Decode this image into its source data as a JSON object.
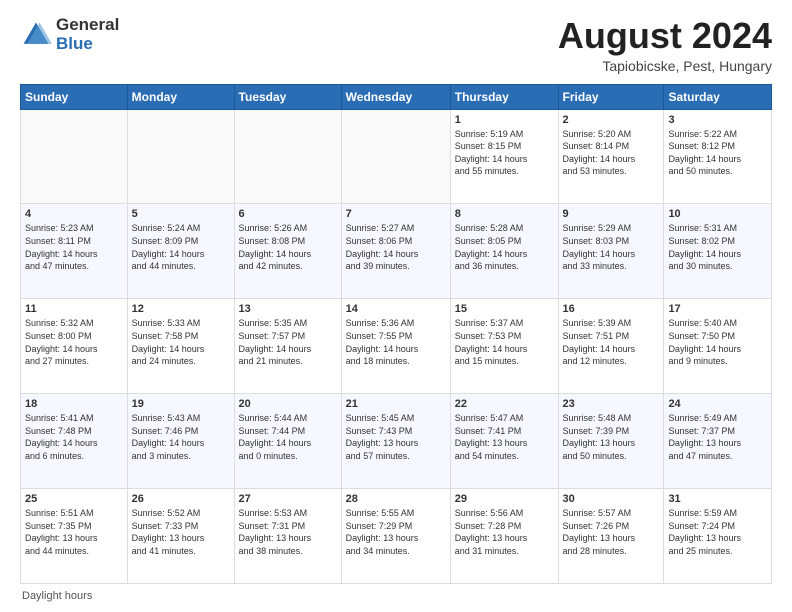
{
  "logo": {
    "general": "General",
    "blue": "Blue"
  },
  "title": "August 2024",
  "subtitle": "Tapiobicske, Pest, Hungary",
  "days_of_week": [
    "Sunday",
    "Monday",
    "Tuesday",
    "Wednesday",
    "Thursday",
    "Friday",
    "Saturday"
  ],
  "footer": "Daylight hours",
  "weeks": [
    [
      {
        "day": "",
        "info": ""
      },
      {
        "day": "",
        "info": ""
      },
      {
        "day": "",
        "info": ""
      },
      {
        "day": "",
        "info": ""
      },
      {
        "day": "1",
        "info": "Sunrise: 5:19 AM\nSunset: 8:15 PM\nDaylight: 14 hours\nand 55 minutes."
      },
      {
        "day": "2",
        "info": "Sunrise: 5:20 AM\nSunset: 8:14 PM\nDaylight: 14 hours\nand 53 minutes."
      },
      {
        "day": "3",
        "info": "Sunrise: 5:22 AM\nSunset: 8:12 PM\nDaylight: 14 hours\nand 50 minutes."
      }
    ],
    [
      {
        "day": "4",
        "info": "Sunrise: 5:23 AM\nSunset: 8:11 PM\nDaylight: 14 hours\nand 47 minutes."
      },
      {
        "day": "5",
        "info": "Sunrise: 5:24 AM\nSunset: 8:09 PM\nDaylight: 14 hours\nand 44 minutes."
      },
      {
        "day": "6",
        "info": "Sunrise: 5:26 AM\nSunset: 8:08 PM\nDaylight: 14 hours\nand 42 minutes."
      },
      {
        "day": "7",
        "info": "Sunrise: 5:27 AM\nSunset: 8:06 PM\nDaylight: 14 hours\nand 39 minutes."
      },
      {
        "day": "8",
        "info": "Sunrise: 5:28 AM\nSunset: 8:05 PM\nDaylight: 14 hours\nand 36 minutes."
      },
      {
        "day": "9",
        "info": "Sunrise: 5:29 AM\nSunset: 8:03 PM\nDaylight: 14 hours\nand 33 minutes."
      },
      {
        "day": "10",
        "info": "Sunrise: 5:31 AM\nSunset: 8:02 PM\nDaylight: 14 hours\nand 30 minutes."
      }
    ],
    [
      {
        "day": "11",
        "info": "Sunrise: 5:32 AM\nSunset: 8:00 PM\nDaylight: 14 hours\nand 27 minutes."
      },
      {
        "day": "12",
        "info": "Sunrise: 5:33 AM\nSunset: 7:58 PM\nDaylight: 14 hours\nand 24 minutes."
      },
      {
        "day": "13",
        "info": "Sunrise: 5:35 AM\nSunset: 7:57 PM\nDaylight: 14 hours\nand 21 minutes."
      },
      {
        "day": "14",
        "info": "Sunrise: 5:36 AM\nSunset: 7:55 PM\nDaylight: 14 hours\nand 18 minutes."
      },
      {
        "day": "15",
        "info": "Sunrise: 5:37 AM\nSunset: 7:53 PM\nDaylight: 14 hours\nand 15 minutes."
      },
      {
        "day": "16",
        "info": "Sunrise: 5:39 AM\nSunset: 7:51 PM\nDaylight: 14 hours\nand 12 minutes."
      },
      {
        "day": "17",
        "info": "Sunrise: 5:40 AM\nSunset: 7:50 PM\nDaylight: 14 hours\nand 9 minutes."
      }
    ],
    [
      {
        "day": "18",
        "info": "Sunrise: 5:41 AM\nSunset: 7:48 PM\nDaylight: 14 hours\nand 6 minutes."
      },
      {
        "day": "19",
        "info": "Sunrise: 5:43 AM\nSunset: 7:46 PM\nDaylight: 14 hours\nand 3 minutes."
      },
      {
        "day": "20",
        "info": "Sunrise: 5:44 AM\nSunset: 7:44 PM\nDaylight: 14 hours\nand 0 minutes."
      },
      {
        "day": "21",
        "info": "Sunrise: 5:45 AM\nSunset: 7:43 PM\nDaylight: 13 hours\nand 57 minutes."
      },
      {
        "day": "22",
        "info": "Sunrise: 5:47 AM\nSunset: 7:41 PM\nDaylight: 13 hours\nand 54 minutes."
      },
      {
        "day": "23",
        "info": "Sunrise: 5:48 AM\nSunset: 7:39 PM\nDaylight: 13 hours\nand 50 minutes."
      },
      {
        "day": "24",
        "info": "Sunrise: 5:49 AM\nSunset: 7:37 PM\nDaylight: 13 hours\nand 47 minutes."
      }
    ],
    [
      {
        "day": "25",
        "info": "Sunrise: 5:51 AM\nSunset: 7:35 PM\nDaylight: 13 hours\nand 44 minutes."
      },
      {
        "day": "26",
        "info": "Sunrise: 5:52 AM\nSunset: 7:33 PM\nDaylight: 13 hours\nand 41 minutes."
      },
      {
        "day": "27",
        "info": "Sunrise: 5:53 AM\nSunset: 7:31 PM\nDaylight: 13 hours\nand 38 minutes."
      },
      {
        "day": "28",
        "info": "Sunrise: 5:55 AM\nSunset: 7:29 PM\nDaylight: 13 hours\nand 34 minutes."
      },
      {
        "day": "29",
        "info": "Sunrise: 5:56 AM\nSunset: 7:28 PM\nDaylight: 13 hours\nand 31 minutes."
      },
      {
        "day": "30",
        "info": "Sunrise: 5:57 AM\nSunset: 7:26 PM\nDaylight: 13 hours\nand 28 minutes."
      },
      {
        "day": "31",
        "info": "Sunrise: 5:59 AM\nSunset: 7:24 PM\nDaylight: 13 hours\nand 25 minutes."
      }
    ]
  ]
}
